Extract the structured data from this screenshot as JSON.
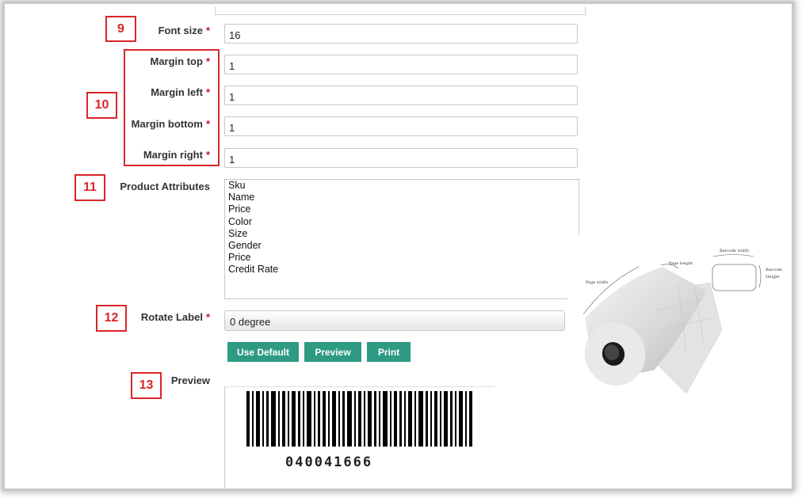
{
  "form": {
    "font_size": {
      "num": "9",
      "label": "Font size",
      "required": "*",
      "value": "16"
    },
    "margins": {
      "num": "10",
      "top": {
        "label": "Margin top",
        "required": "*",
        "value": "1"
      },
      "left": {
        "label": "Margin left",
        "required": "*",
        "value": "1"
      },
      "bottom": {
        "label": "Margin bottom",
        "required": "*",
        "value": "1"
      },
      "right": {
        "label": "Margin right",
        "required": "*",
        "value": "1"
      }
    },
    "attributes": {
      "num": "11",
      "label": "Product Attributes",
      "options": [
        "Sku",
        "Name",
        "Price",
        "Color",
        "Size",
        "Gender",
        "Price",
        "Credit Rate"
      ]
    },
    "rotate": {
      "num": "12",
      "label": "Rotate Label",
      "required": "*",
      "value": "0 degree"
    },
    "buttons": {
      "use_default": "Use Default",
      "preview": "Preview",
      "print": "Print"
    },
    "preview": {
      "num": "13",
      "label": "Preview",
      "barcode_text": "040041666"
    }
  },
  "diagram": {
    "page_height": "Page height",
    "page_width": "Page width",
    "barcode_width": "Barcode width",
    "barcode_height_1": "Barcode",
    "barcode_height_2": "Height"
  },
  "colors": {
    "accent_button": "#2e9a84",
    "callout_red": "#d9262a",
    "required_star": "#c8102e"
  }
}
